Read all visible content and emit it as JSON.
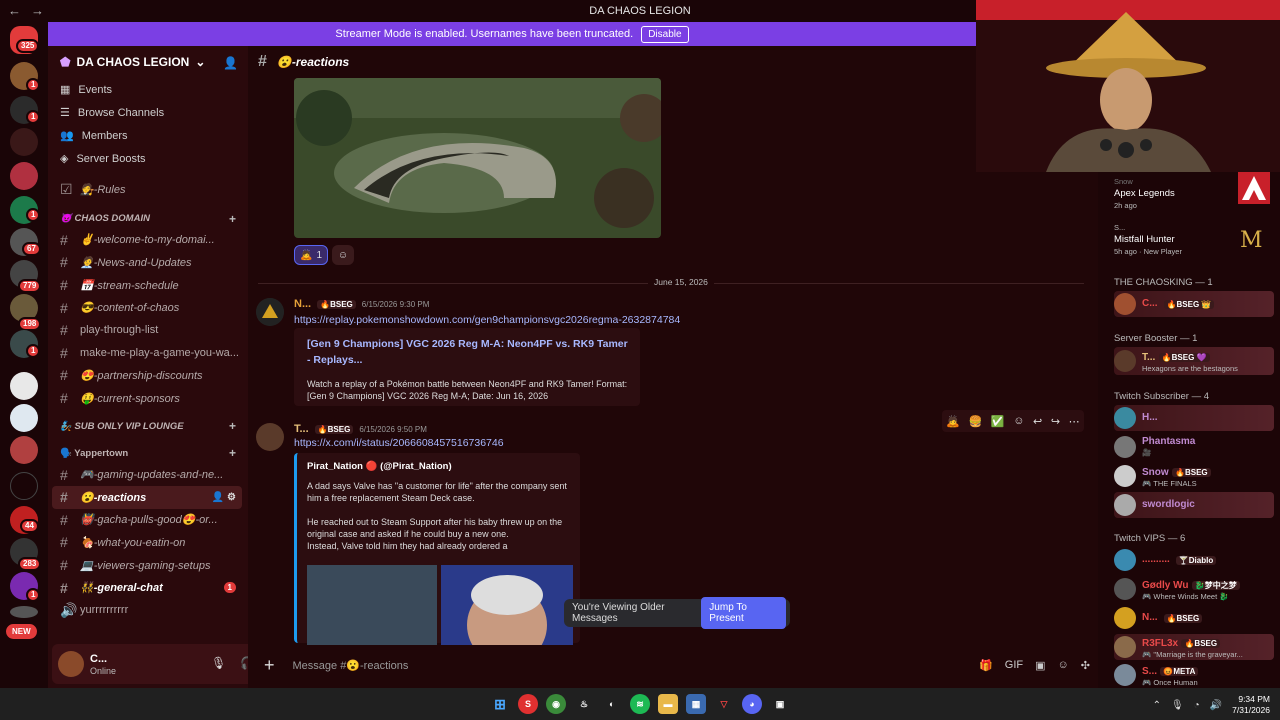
{
  "window": {
    "title": "DA CHAOS LEGION"
  },
  "banner": {
    "text": "Streamer Mode is enabled. Usernames have been truncated.",
    "button": "Disable"
  },
  "rail": {
    "badges": [
      "325",
      "1",
      "1",
      "1",
      "67",
      "779",
      "198",
      "1",
      "44",
      "283",
      "1"
    ],
    "new_label": "NEW"
  },
  "server": {
    "name": "DA CHAOS LEGION",
    "nav": [
      "Events",
      "Browse Channels",
      "Members",
      "Server Boosts"
    ],
    "rules": "🧑‍⚖️-Rules",
    "categories": [
      {
        "name": "😈 CHAOS DOMAIN",
        "channels": [
          "✌️-welcome-to-my-domai...",
          "🧑‍💼-News-and-Updates",
          "📅-stream-schedule",
          "😎-content-of-chaos",
          "play-through-list",
          "make-me-play-a-game-you-wa...",
          "😍-partnership-discounts",
          "🤑-current-sponsors"
        ]
      },
      {
        "name": "🧞 SUB ONLY VIP LOUNGE",
        "channels": []
      },
      {
        "name": "🗣️ Yappertown",
        "channels": [
          "🎮-gaming-updates-and-ne...",
          "😮-reactions",
          "👹-gacha-pulls-good😍-or...",
          "🍖-what-you-eatin-on",
          "💻-viewers-gaming-setups",
          "👯-general-chat",
          "yurrrrrrrrrr"
        ]
      }
    ],
    "general_chat_count": "1"
  },
  "user": {
    "name": "C...",
    "status": "Online"
  },
  "channel": {
    "name": "😮-reactions"
  },
  "reactions": {
    "first_count": "1"
  },
  "date_separator": "June 15, 2026",
  "messages": [
    {
      "author": "N...",
      "tag": "🔥BSEG",
      "time": "6/15/2026 9:30 PM",
      "link": "https://replay.pokemonshowdown.com/gen9championsvgc2026regma-2632874784",
      "embed_title": "[Gen 9 Champions] VGC 2026 Reg M-A: Neon4PF vs. RK9 Tamer - Replays...",
      "embed_desc": "Watch a replay of a Pokémon battle between Neon4PF and RK9 Tamer! Format: [Gen 9 Champions] VGC 2026 Reg M-A; Date: Jun 16, 2026"
    },
    {
      "author": "T...",
      "tag": "🔥BSEG",
      "time": "6/15/2026 9:50 PM",
      "link": "https://x.com/i/status/2066608457516736746",
      "embed_author": "Pirat_Nation 🔴 (@Pirat_Nation)",
      "embed_p1": "A dad says Valve has \"a customer for life\" after the company sent him a free replacement Steam Deck case.",
      "embed_p2": "He reached out to Steam Support after his baby threw up on the original case and asked if he could buy a new one.",
      "embed_p3": "Instead, Valve told him they had already ordered a"
    }
  ],
  "jump": {
    "text": "You're Viewing Older Messages",
    "button": "Jump To Present"
  },
  "composer": {
    "placeholder": "Message #😮-reactions"
  },
  "members": {
    "activities": [
      {
        "name": "Snow",
        "game": "Apex Legends",
        "sub": "2h ago"
      },
      {
        "name": "S...",
        "game": "Mistfall Hunter",
        "sub": "5h ago · New Player"
      }
    ],
    "sections": [
      {
        "title": "THE CHAOSKING — 1",
        "members": [
          {
            "name": "C...",
            "tag": "🔥BSEG 👑",
            "status": ""
          }
        ]
      },
      {
        "title": "Server Booster — 1",
        "members": [
          {
            "name": "T...",
            "tag": "🔥BSEG 💜",
            "status": "Hexagons are the bestagons"
          }
        ]
      },
      {
        "title": "Twitch Subscriber — 4",
        "members": [
          {
            "name": "H...",
            "tag": "",
            "status": ""
          },
          {
            "name": "Phantasma",
            "tag": "",
            "status": "🎥"
          },
          {
            "name": "Snow",
            "tag": "🔥BSEG",
            "status": "🎮 THE FINALS"
          },
          {
            "name": "swordlogic",
            "tag": "",
            "status": ""
          }
        ]
      },
      {
        "title": "Twitch VIPS — 6",
        "members": [
          {
            "name": "..........",
            "tag": "🍸Diablo",
            "status": ""
          },
          {
            "name": "Gødly Wu",
            "tag": "🐉梦中之梦",
            "status": "🎮 Where Winds Meet 🐉"
          },
          {
            "name": "N...",
            "tag": "🔥BSEG",
            "status": ""
          },
          {
            "name": "R3FL3x",
            "tag": "🔥BSEG",
            "status": "🎮 \"Marriage is the graveyar..."
          },
          {
            "name": "S...",
            "tag": "😡META",
            "status": "🎮 Once Human"
          }
        ]
      }
    ]
  },
  "taskbar": {
    "time": "9:34 PM",
    "date": "7/31/2026"
  },
  "colors": {
    "accent": "#7b3fe4",
    "link": "#a8b8ff",
    "badge": "#e23b3b",
    "jump": "#5865f2"
  }
}
